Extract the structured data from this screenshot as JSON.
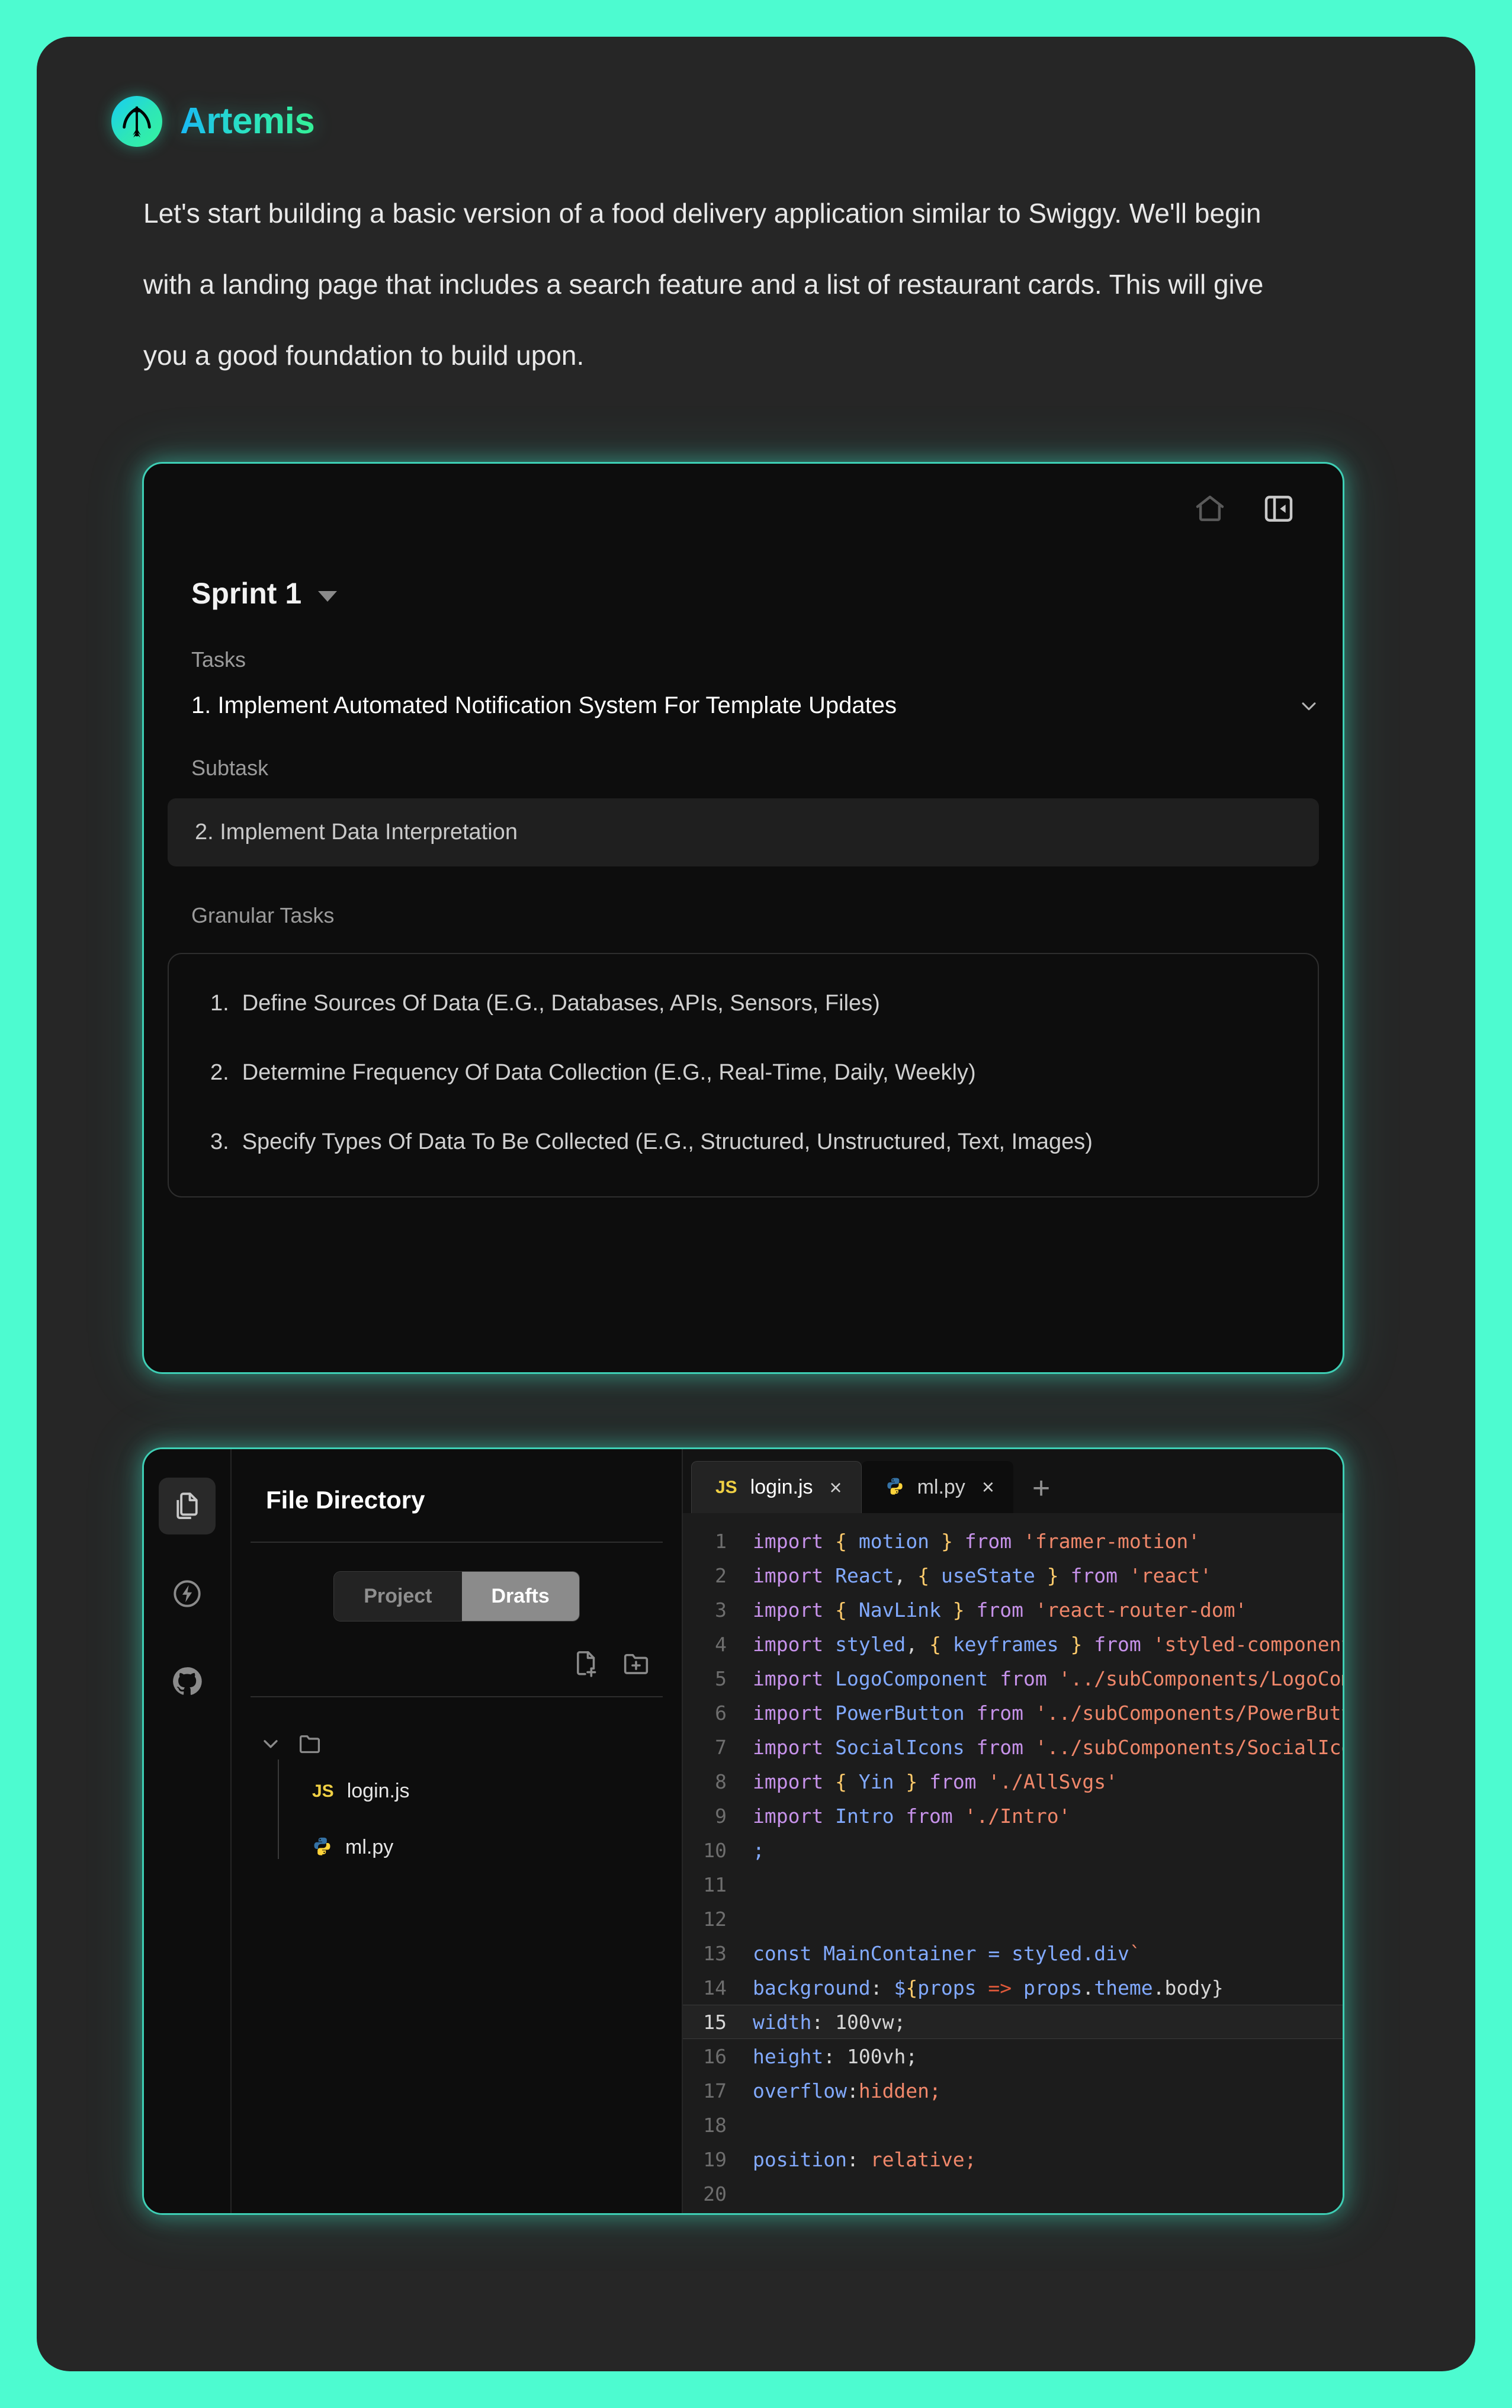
{
  "theme": {
    "page_bg": "#4dfbd0",
    "shell_bg": "#262626",
    "card_bg": "#0d0d0d",
    "glow_border": "#3ecfb5",
    "brand_gradient_from": "#18b9f5",
    "brand_gradient_to": "#34f197"
  },
  "brand": {
    "title": "Artemis",
    "logo_icon": "bow-and-arrow-icon"
  },
  "intro": {
    "paragraph": "Let's start building a basic version of a food delivery application similar to Swiggy. We'll begin with a landing page that includes a search feature and a list of restaurant cards. This will give you a good foundation to build upon."
  },
  "sprint_card": {
    "home_icon": "home-icon",
    "collapse_icon": "panel-collapse-icon",
    "sprint_name": "Sprint 1",
    "sprint_caret": "chevron-down-icon",
    "tasks_label": "Tasks",
    "task": {
      "text": "1. Implement Automated Notification System For Template Updates",
      "chevron": "chevron-down-icon"
    },
    "subtask_label": "Subtask",
    "subtask": {
      "text": "2. Implement Data Interpretation"
    },
    "granular_label": "Granular Tasks",
    "granular_tasks": [
      {
        "num": "1.",
        "text": "Define Sources Of Data (E.G., Databases, APIs, Sensors, Files)"
      },
      {
        "num": "2.",
        "text": "Determine Frequency Of Data Collection (E.G., Real-Time, Daily, Weekly)"
      },
      {
        "num": "3.",
        "text": "Specify Types Of Data To Be Collected (E.G., Structured, Unstructured, Text, Images)"
      }
    ]
  },
  "ide_card": {
    "rail": [
      {
        "icon": "files-icon",
        "active": true
      },
      {
        "icon": "lightning-circle-icon",
        "active": false
      },
      {
        "icon": "github-icon",
        "active": false
      }
    ],
    "file_panel": {
      "title": "File Directory",
      "segments": [
        {
          "label": "Project",
          "active": false
        },
        {
          "label": "Drafts",
          "active": true
        }
      ],
      "actions": [
        {
          "icon": "new-file-icon"
        },
        {
          "icon": "new-folder-icon"
        }
      ],
      "tree": {
        "folder_chevron": "chevron-down-icon",
        "folder_icon": "folder-icon",
        "files": [
          {
            "name": "login.js",
            "icon": "js-icon"
          },
          {
            "name": "ml.py",
            "icon": "python-icon"
          }
        ]
      }
    },
    "editor": {
      "tabs": [
        {
          "name": "login.js",
          "icon": "js-icon",
          "active": true,
          "close": "×"
        },
        {
          "name": "ml.py",
          "icon": "python-icon",
          "active": false,
          "close": "×"
        }
      ],
      "add_tab": "+",
      "current_line": 15,
      "lines": [
        {
          "n": "1",
          "tokens": [
            {
              "t": "import",
              "c": "kw"
            },
            {
              "t": " ",
              "c": "pl"
            },
            {
              "t": "{",
              "c": "br"
            },
            {
              "t": " ",
              "c": "pl"
            },
            {
              "t": "motion",
              "c": "id"
            },
            {
              "t": " ",
              "c": "pl"
            },
            {
              "t": "}",
              "c": "br"
            },
            {
              "t": " ",
              "c": "pl"
            },
            {
              "t": "from",
              "c": "kw"
            },
            {
              "t": " ",
              "c": "pl"
            },
            {
              "t": "'framer-motion'",
              "c": "str"
            }
          ]
        },
        {
          "n": "2",
          "tokens": [
            {
              "t": "import",
              "c": "kw"
            },
            {
              "t": " ",
              "c": "pl"
            },
            {
              "t": "React",
              "c": "id"
            },
            {
              "t": ", ",
              "c": "pl"
            },
            {
              "t": "{",
              "c": "br"
            },
            {
              "t": " ",
              "c": "pl"
            },
            {
              "t": "useState",
              "c": "id"
            },
            {
              "t": " ",
              "c": "pl"
            },
            {
              "t": "}",
              "c": "br"
            },
            {
              "t": " ",
              "c": "pl"
            },
            {
              "t": "from",
              "c": "kw"
            },
            {
              "t": " ",
              "c": "pl"
            },
            {
              "t": "'react'",
              "c": "str"
            }
          ]
        },
        {
          "n": "3",
          "tokens": [
            {
              "t": "import",
              "c": "kw"
            },
            {
              "t": " ",
              "c": "pl"
            },
            {
              "t": "{",
              "c": "br"
            },
            {
              "t": " ",
              "c": "pl"
            },
            {
              "t": "NavLink",
              "c": "id"
            },
            {
              "t": " ",
              "c": "pl"
            },
            {
              "t": "}",
              "c": "br"
            },
            {
              "t": " ",
              "c": "pl"
            },
            {
              "t": "from",
              "c": "kw"
            },
            {
              "t": " ",
              "c": "pl"
            },
            {
              "t": "'react-router-dom'",
              "c": "str"
            }
          ]
        },
        {
          "n": "4",
          "tokens": [
            {
              "t": "import",
              "c": "kw"
            },
            {
              "t": " ",
              "c": "pl"
            },
            {
              "t": "styled",
              "c": "id"
            },
            {
              "t": ", ",
              "c": "pl"
            },
            {
              "t": "{",
              "c": "br"
            },
            {
              "t": " ",
              "c": "pl"
            },
            {
              "t": "keyframes",
              "c": "id"
            },
            {
              "t": " ",
              "c": "pl"
            },
            {
              "t": "}",
              "c": "br"
            },
            {
              "t": " ",
              "c": "pl"
            },
            {
              "t": "from",
              "c": "kw"
            },
            {
              "t": " ",
              "c": "pl"
            },
            {
              "t": "'styled-components'",
              "c": "str"
            }
          ]
        },
        {
          "n": "5",
          "tokens": [
            {
              "t": "import",
              "c": "kw"
            },
            {
              "t": " ",
              "c": "pl"
            },
            {
              "t": "LogoComponent",
              "c": "id"
            },
            {
              "t": " ",
              "c": "pl"
            },
            {
              "t": "from",
              "c": "kw"
            },
            {
              "t": " ",
              "c": "pl"
            },
            {
              "t": "'../subComponents/LogoComponent'",
              "c": "str"
            }
          ]
        },
        {
          "n": "6",
          "tokens": [
            {
              "t": "import",
              "c": "kw"
            },
            {
              "t": " ",
              "c": "pl"
            },
            {
              "t": "PowerButton",
              "c": "id"
            },
            {
              "t": " ",
              "c": "pl"
            },
            {
              "t": "from",
              "c": "kw"
            },
            {
              "t": " ",
              "c": "pl"
            },
            {
              "t": "'../subComponents/PowerButton'",
              "c": "str"
            }
          ]
        },
        {
          "n": "7",
          "tokens": [
            {
              "t": "import",
              "c": "kw"
            },
            {
              "t": " ",
              "c": "pl"
            },
            {
              "t": "SocialIcons",
              "c": "id"
            },
            {
              "t": " ",
              "c": "pl"
            },
            {
              "t": "from",
              "c": "kw"
            },
            {
              "t": " ",
              "c": "pl"
            },
            {
              "t": "'../subComponents/SocialIcons'",
              "c": "str"
            }
          ]
        },
        {
          "n": "8",
          "tokens": [
            {
              "t": "import",
              "c": "kw"
            },
            {
              "t": " ",
              "c": "pl"
            },
            {
              "t": "{",
              "c": "br"
            },
            {
              "t": " ",
              "c": "pl"
            },
            {
              "t": "Yin",
              "c": "id"
            },
            {
              "t": " ",
              "c": "pl"
            },
            {
              "t": "}",
              "c": "br"
            },
            {
              "t": " ",
              "c": "pl"
            },
            {
              "t": "from",
              "c": "kw"
            },
            {
              "t": " ",
              "c": "pl"
            },
            {
              "t": "'./AllSvgs'",
              "c": "str"
            }
          ]
        },
        {
          "n": "9",
          "tokens": [
            {
              "t": "import",
              "c": "kw"
            },
            {
              "t": " ",
              "c": "pl"
            },
            {
              "t": "Intro",
              "c": "id"
            },
            {
              "t": " ",
              "c": "pl"
            },
            {
              "t": "from",
              "c": "kw"
            },
            {
              "t": " ",
              "c": "pl"
            },
            {
              "t": "'./Intro'",
              "c": "str"
            }
          ]
        },
        {
          "n": "10",
          "tokens": [
            {
              "t": ";",
              "c": "id"
            }
          ]
        },
        {
          "n": "11",
          "tokens": []
        },
        {
          "n": "12",
          "tokens": []
        },
        {
          "n": "13",
          "tokens": [
            {
              "t": "const",
              "c": "id"
            },
            {
              "t": " ",
              "c": "pl"
            },
            {
              "t": "MainContainer",
              "c": "id"
            },
            {
              "t": " = ",
              "c": "id"
            },
            {
              "t": "styled",
              "c": "id"
            },
            {
              "t": ".",
              "c": "id"
            },
            {
              "t": "div",
              "c": "id"
            },
            {
              "t": "`",
              "c": "str"
            }
          ]
        },
        {
          "n": "14",
          "tokens": [
            {
              "t": "background",
              "c": "prop"
            },
            {
              "t": ": ",
              "c": "pl"
            },
            {
              "t": "$",
              "c": "prop"
            },
            {
              "t": "{",
              "c": "br"
            },
            {
              "t": "props",
              "c": "id"
            },
            {
              "t": " ",
              "c": "pl"
            },
            {
              "t": "=>",
              "c": "op"
            },
            {
              "t": " ",
              "c": "pl"
            },
            {
              "t": "props",
              "c": "id"
            },
            {
              "t": ".",
              "c": "pl"
            },
            {
              "t": "theme",
              "c": "id"
            },
            {
              "t": ".body}",
              "c": "pl"
            }
          ]
        },
        {
          "n": "15",
          "tokens": [
            {
              "t": "width",
              "c": "prop"
            },
            {
              "t": ": ",
              "c": "pl"
            },
            {
              "t": "100vw;",
              "c": "num"
            }
          ]
        },
        {
          "n": "16",
          "tokens": [
            {
              "t": "height",
              "c": "prop"
            },
            {
              "t": ": ",
              "c": "pl"
            },
            {
              "t": "100vh;",
              "c": "num"
            }
          ]
        },
        {
          "n": "17",
          "tokens": [
            {
              "t": "overflow",
              "c": "prop"
            },
            {
              "t": ":",
              "c": "pl"
            },
            {
              "t": "hidden;",
              "c": "val"
            }
          ]
        },
        {
          "n": "18",
          "tokens": []
        },
        {
          "n": "19",
          "tokens": [
            {
              "t": "position",
              "c": "prop"
            },
            {
              "t": ": ",
              "c": "pl"
            },
            {
              "t": "relative;",
              "c": "val"
            }
          ]
        },
        {
          "n": "20",
          "tokens": []
        }
      ]
    }
  }
}
